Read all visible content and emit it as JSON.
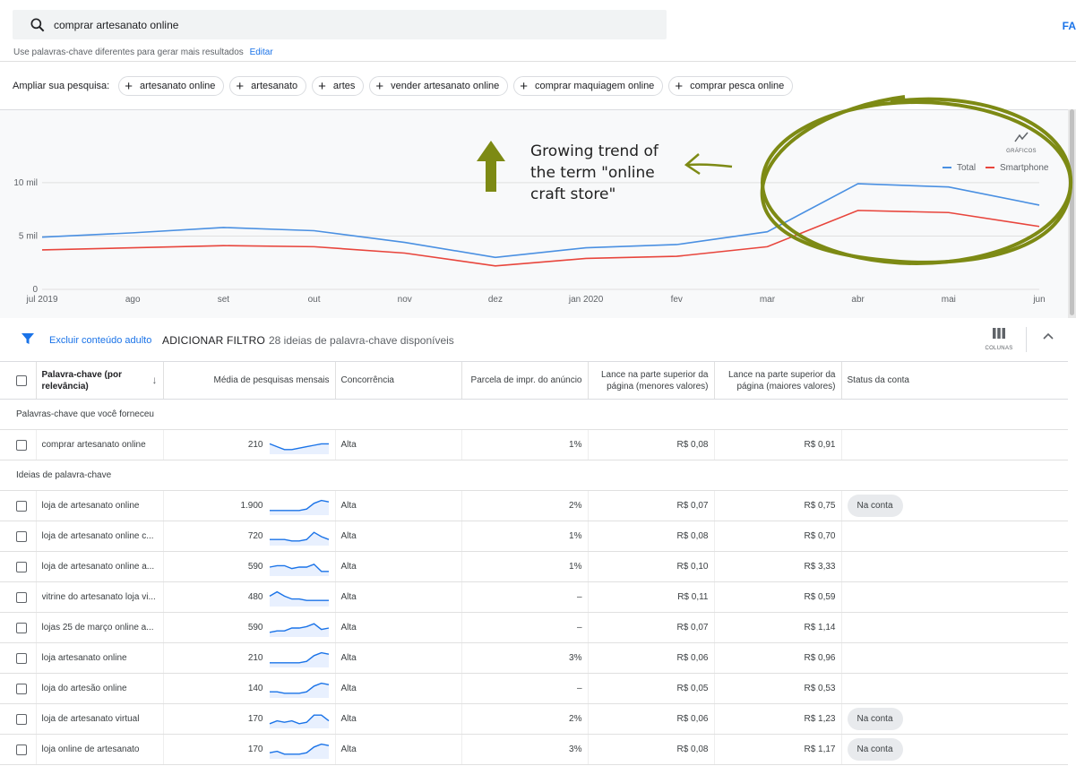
{
  "search": {
    "query": "comprar artesanato online"
  },
  "top_right": {
    "label": "FA"
  },
  "hint": {
    "text": "Use palavras-chave diferentes para gerar mais resultados",
    "edit": "Editar"
  },
  "expand": {
    "label": "Ampliar sua pesquisa:",
    "chips": [
      "artesanato online",
      "artesanato",
      "artes",
      "vender artesanato online",
      "comprar maquiagem online",
      "comprar pesca online"
    ]
  },
  "graphs": {
    "label": "GRÁFICOS",
    "icon": "trend-line-icon"
  },
  "annotation": {
    "line1": "Growing trend of",
    "line2": "the term \"online",
    "line3": "craft store\""
  },
  "colors": {
    "total": "#4a90e2",
    "smartphone": "#e8453c",
    "annotation": "#7d8a14",
    "accent": "#1a73e8"
  },
  "chart_data": {
    "type": "line",
    "x": [
      "jul 2019",
      "ago",
      "set",
      "out",
      "nov",
      "dez",
      "jan 2020",
      "fev",
      "mar",
      "abr",
      "mai",
      "jun"
    ],
    "series": [
      {
        "name": "Total",
        "values": [
          4900,
          5300,
          5800,
          5500,
          4400,
          3000,
          3900,
          4200,
          5400,
          9900,
          9600,
          7900
        ]
      },
      {
        "name": "Smartphone",
        "values": [
          3700,
          3900,
          4100,
          4000,
          3400,
          2200,
          2900,
          3100,
          4000,
          7400,
          7200,
          5900
        ]
      }
    ],
    "yticks": [
      "0",
      "5 mil",
      "10 mil"
    ],
    "ylim": [
      0,
      11000
    ],
    "legend_position": "top-right",
    "grid": true
  },
  "toolbar": {
    "exclude": "Excluir conteúdo adulto",
    "add_filter": "ADICIONAR FILTRO",
    "count": "28 ideias de palavra-chave disponíveis",
    "columns_label": "COLUNAS"
  },
  "table": {
    "headers": {
      "keyword": "Palavra-chave (por relevância)",
      "avg": "Média de pesquisas mensais",
      "competition": "Concorrência",
      "share": "Parcela de impr. do anúncio",
      "bid_low": "Lance na parte superior da página (menores valores)",
      "bid_high": "Lance na parte superior da página (maiores valores)",
      "status": "Status da conta"
    },
    "section_provided": "Palavras-chave que você forneceu",
    "section_ideas": "Ideias de palavra-chave",
    "provided": [
      {
        "kw": "comprar artesanato online",
        "avg": "210",
        "comp": "Alta",
        "share": "1%",
        "low": "R$ 0,08",
        "high": "R$ 0,91",
        "status": "",
        "spark": [
          6,
          4,
          2,
          2,
          3,
          4,
          5,
          6,
          6
        ]
      }
    ],
    "ideas": [
      {
        "kw": "loja de artesanato online",
        "avg": "1.900",
        "comp": "Alta",
        "share": "2%",
        "low": "R$ 0,07",
        "high": "R$ 0,75",
        "status": "Na conta",
        "spark": [
          2,
          2,
          2,
          2,
          2,
          3,
          7,
          9,
          8
        ]
      },
      {
        "kw": "loja de artesanato online c...",
        "avg": "720",
        "comp": "Alta",
        "share": "1%",
        "low": "R$ 0,08",
        "high": "R$ 0,70",
        "status": "",
        "spark": [
          3,
          3,
          3,
          2,
          2,
          3,
          8,
          5,
          3
        ]
      },
      {
        "kw": "loja de artesanato online a...",
        "avg": "590",
        "comp": "Alta",
        "share": "1%",
        "low": "R$ 0,10",
        "high": "R$ 3,33",
        "status": "",
        "spark": [
          5,
          6,
          6,
          4,
          5,
          5,
          7,
          2,
          2
        ]
      },
      {
        "kw": "vitrine do artesanato loja vi...",
        "avg": "480",
        "comp": "Alta",
        "share": "–",
        "low": "R$ 0,11",
        "high": "R$ 0,59",
        "status": "",
        "spark": [
          6,
          9,
          6,
          4,
          4,
          3,
          3,
          3,
          3
        ]
      },
      {
        "kw": "lojas 25 de março online a...",
        "avg": "590",
        "comp": "Alta",
        "share": "–",
        "low": "R$ 0,07",
        "high": "R$ 1,14",
        "status": "",
        "spark": [
          2,
          3,
          3,
          5,
          5,
          6,
          8,
          4,
          5
        ]
      },
      {
        "kw": "loja artesanato online",
        "avg": "210",
        "comp": "Alta",
        "share": "3%",
        "low": "R$ 0,06",
        "high": "R$ 0,96",
        "status": "",
        "spark": [
          2,
          2,
          2,
          2,
          2,
          3,
          7,
          9,
          8
        ]
      },
      {
        "kw": "loja do artesão online",
        "avg": "140",
        "comp": "Alta",
        "share": "–",
        "low": "R$ 0,05",
        "high": "R$ 0,53",
        "status": "",
        "spark": [
          3,
          3,
          2,
          2,
          2,
          3,
          7,
          9,
          8
        ]
      },
      {
        "kw": "loja de artesanato virtual",
        "avg": "170",
        "comp": "Alta",
        "share": "2%",
        "low": "R$ 0,06",
        "high": "R$ 1,23",
        "status": "Na conta",
        "spark": [
          2,
          4,
          3,
          4,
          2,
          3,
          8,
          8,
          4
        ]
      },
      {
        "kw": "loja online de artesanato",
        "avg": "170",
        "comp": "Alta",
        "share": "3%",
        "low": "R$ 0,08",
        "high": "R$ 1,17",
        "status": "Na conta",
        "spark": [
          3,
          4,
          2,
          2,
          2,
          3,
          7,
          9,
          8
        ]
      }
    ]
  }
}
